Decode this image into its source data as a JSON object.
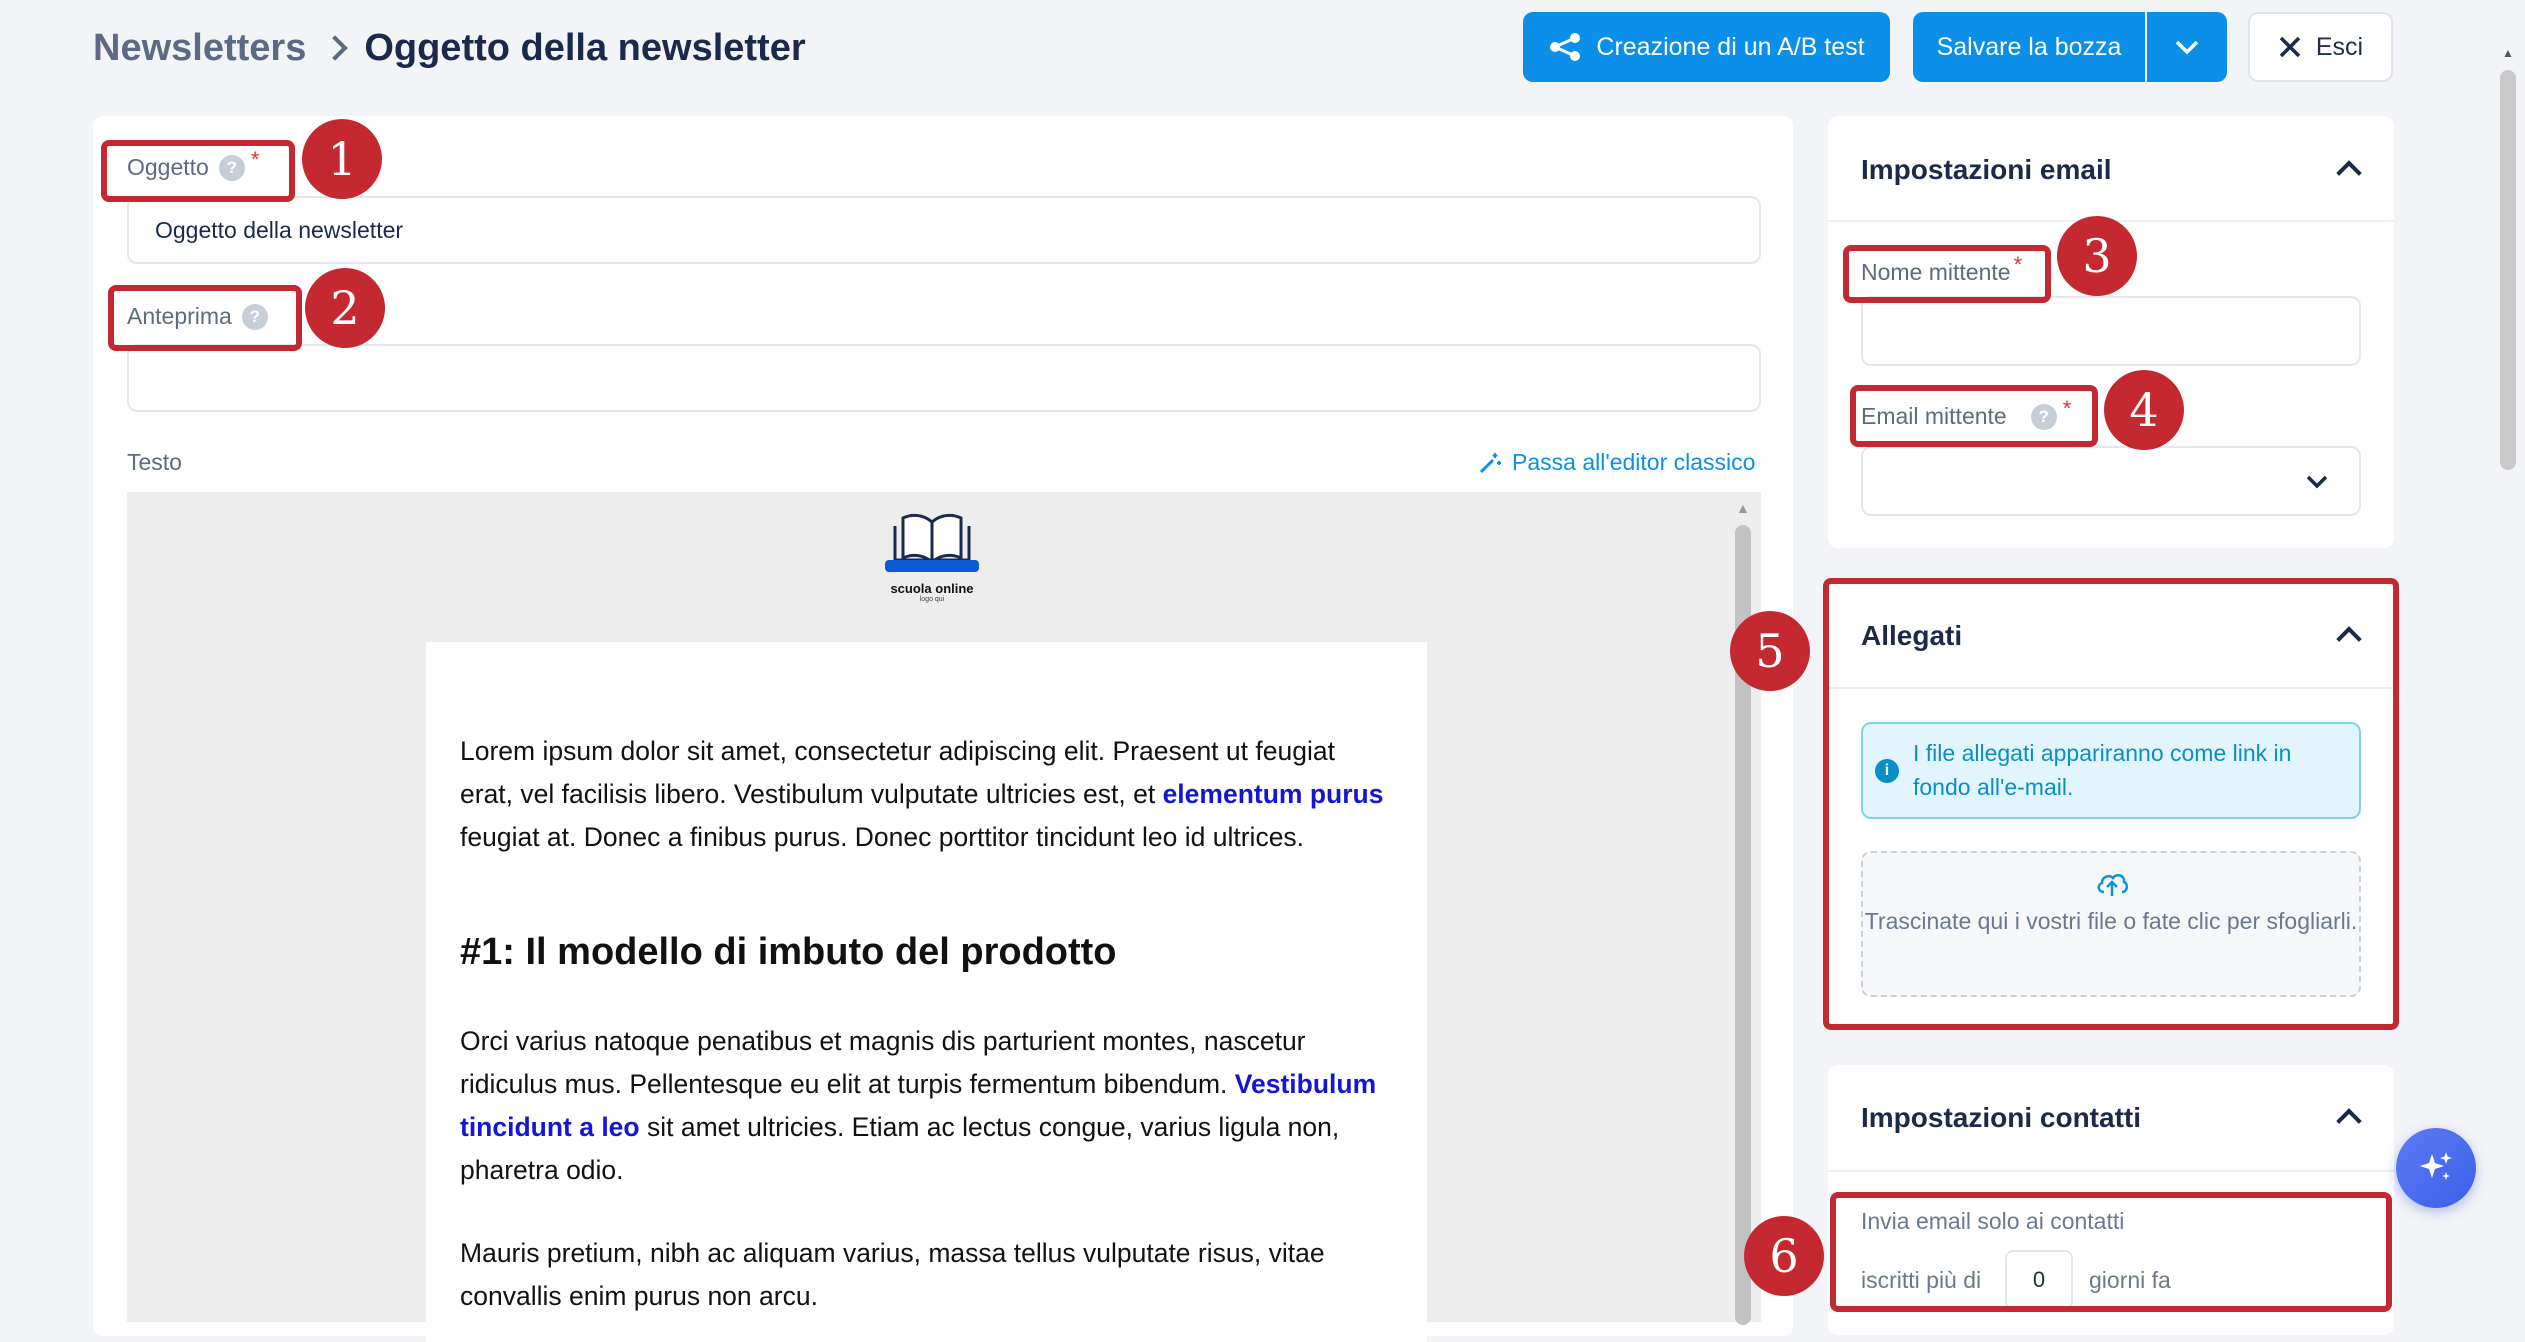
{
  "header": {
    "breadcrumb_parent": "Newsletters",
    "breadcrumb_current": "Oggetto della newsletter",
    "ab_test_label": "Creazione di un A/B test",
    "save_draft_label": "Salvare la bozza",
    "exit_label": "Esci"
  },
  "form": {
    "subject_label": "Oggetto",
    "subject_value": "Oggetto della newsletter",
    "preview_label": "Anteprima",
    "preview_value": "",
    "text_label": "Testo",
    "classic_editor_link": "Passa all'editor classico"
  },
  "email_content": {
    "logo_text": "scuola online",
    "logo_subtext": "logo qui",
    "para1_a": "Lorem ipsum dolor sit amet, consectetur adipiscing elit. Praesent ut feugiat erat, vel facilisis libero. Vestibulum vulputate ultricies est, et ",
    "para1_link": "elementum purus",
    "para1_b": " feugiat at. Donec a finibus purus. Donec porttitor tincidunt leo id ultrices.",
    "heading1": "#1: Il modello di imbuto del prodotto",
    "para2_a": "Orci varius natoque penatibus et magnis dis parturient montes, nascetur ridiculus mus. Pellentesque eu elit at turpis fermentum bibendum. ",
    "para2_link": "Vestibulum tincidunt a leo",
    "para2_b": " sit amet ultricies. Etiam ac lectus congue, varius ligula non, pharetra odio.",
    "para3": "Mauris pretium, nibh ac aliquam varius, massa tellus vulputate risus, vitae convallis enim purus non arcu."
  },
  "email_settings": {
    "title": "Impostazioni email",
    "sender_name_label": "Nome mittente",
    "sender_name_value": "",
    "sender_email_label": "Email mittente",
    "sender_email_value": ""
  },
  "attachments": {
    "title": "Allegati",
    "info_text": "I file allegati appariranno come link in fondo all'e-mail.",
    "dropzone_text": "Trascinate qui i vostri file o fate clic per sfogliarli."
  },
  "contact_settings": {
    "title": "Impostazioni contatti",
    "line1": "Invia email solo ai contatti",
    "prefix": "iscritti più di",
    "days_value": "0",
    "suffix": "giorni fa"
  },
  "annotations": {
    "n1": "1",
    "n2": "2",
    "n3": "3",
    "n4": "4",
    "n5": "5",
    "n6": "6"
  },
  "colors": {
    "primary": "#0b8fe8",
    "annotation": "#c42830",
    "info_bg": "#e3f5fc",
    "link": "#1515d6"
  }
}
